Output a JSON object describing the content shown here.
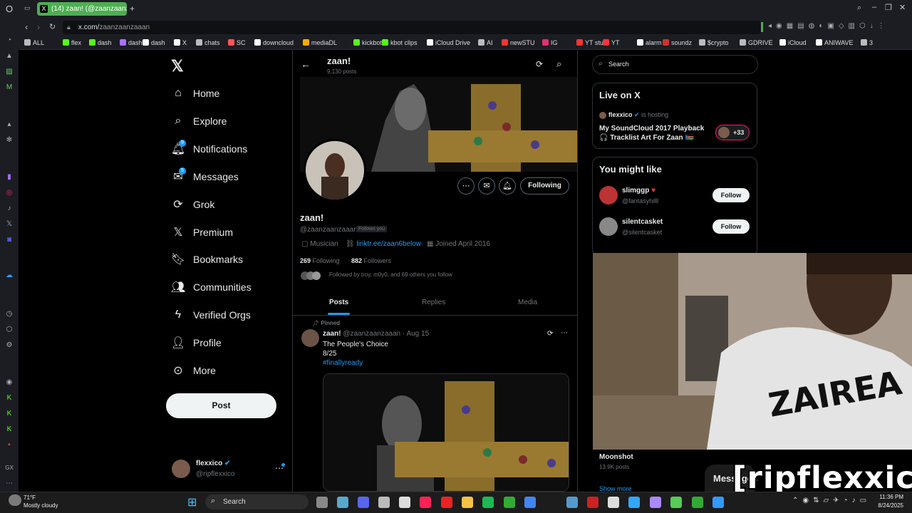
{
  "browser": {
    "tab_title": "(14) zaan! (@zaanzaanzaa",
    "url_host": "x.com/",
    "url_path": "zaanzaanzaaan",
    "bookmarks": [
      "ALL",
      "flex",
      "dash",
      "dash",
      "dash",
      "X",
      "chats",
      "SC",
      "downcloud",
      "mediaDL",
      "kickbot",
      "kbot clips",
      "iCloud Drive",
      "AI",
      "newSTU",
      "IG",
      "YT stu",
      "YT",
      "alarm",
      "soundz",
      "$crypto",
      "GDRIVE",
      "iCloud",
      "ANIWAVE",
      "3"
    ],
    "colors": {
      "active_tab": "#4caf50",
      "chrome_bg": "#1b1d22"
    }
  },
  "nav": {
    "items": [
      {
        "label": "Home",
        "icon": "home-icon"
      },
      {
        "label": "Explore",
        "icon": "search-icon"
      },
      {
        "label": "Notifications",
        "icon": "bell-icon",
        "badge": "9"
      },
      {
        "label": "Messages",
        "icon": "envelope-icon",
        "badge": "5"
      },
      {
        "label": "Grok",
        "icon": "grok-icon"
      },
      {
        "label": "Premium",
        "icon": "x-logo-icon"
      },
      {
        "label": "Bookmarks",
        "icon": "bookmark-icon"
      },
      {
        "label": "Communities",
        "icon": "people-icon"
      },
      {
        "label": "Verified Orgs",
        "icon": "lightning-icon"
      },
      {
        "label": "Profile",
        "icon": "person-icon"
      },
      {
        "label": "More",
        "icon": "more-circle-icon"
      }
    ],
    "post_label": "Post",
    "account": {
      "name": "flexxico",
      "handle": "@ripflexxico"
    }
  },
  "profile": {
    "header_name": "zaan!",
    "post_count": "9,130 posts",
    "name": "zaan!",
    "handle": "@zaanzaanzaaan",
    "follows_you": "Follows you",
    "category": "Musician",
    "link": "linktr.ee/zaan6below",
    "joined": "Joined April 2016",
    "following_count": "269",
    "following_label": "Following",
    "followers_count": "882",
    "followers_label": "Followers",
    "followed_by": "Followed by troy, m0y0, and 69 others you follow",
    "following_button": "Following",
    "tabs": [
      "Posts",
      "Replies",
      "Media"
    ]
  },
  "pinned_post": {
    "pinned_label": "Pinned",
    "author": "zaan!",
    "meta": "@zaanzaanzaaan · Aug 15",
    "line1": "The People's Choice",
    "line2": "8/25",
    "hashtag": "#finallyready"
  },
  "sidebar_right": {
    "search_placeholder": "Search",
    "live_title": "Live on X",
    "live_host": "flexxico",
    "live_hosting": "is hosting",
    "live_text1": "My SoundCloud 2017 Playback",
    "live_text2": "🎧 Tracklist Art For Zaan 🇸🇸",
    "live_count": "+33",
    "might_like_title": "You might like",
    "suggestions": [
      {
        "name": "slimggp",
        "handle": "@fantasyhilll",
        "button": "Follow"
      },
      {
        "name": "silentcasket",
        "handle": "@silentcasket",
        "button": "Follow"
      }
    ],
    "trend_name": "Moonshot",
    "trend_posts": "13.9K posts",
    "show_more": "Show more",
    "messages_label": "Messages"
  },
  "overlay": {
    "watermark": "[ripflexxico]"
  },
  "taskbar": {
    "weather_temp": "71°F",
    "weather_desc": "Mostly cloudy",
    "search_label": "Search",
    "time": "11:36 PM",
    "date": "8/24/2025"
  }
}
